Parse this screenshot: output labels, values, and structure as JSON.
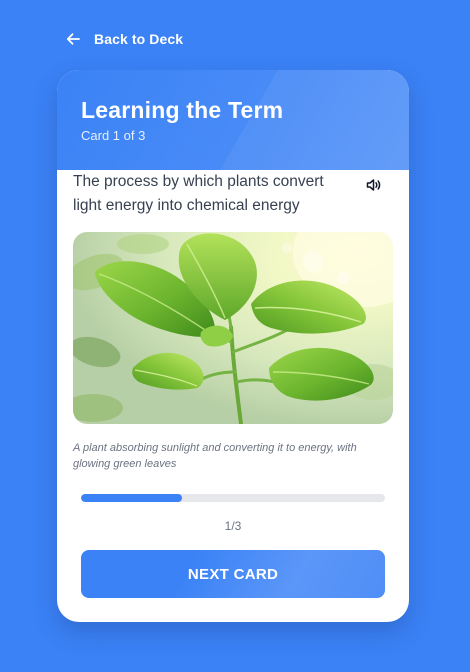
{
  "nav": {
    "back_label": "Back to Deck",
    "back_icon": "arrow-left-icon"
  },
  "card": {
    "title": "Learning the Term",
    "subtitle": "Card 1 of 3",
    "definition": "The process by which plants convert light energy into chemical energy",
    "audio_icon": "speaker-icon",
    "image_alt": "A plant absorbing sunlight and converting it to energy, with glowing green leaves",
    "caption": "A plant absorbing sunlight and converting it to energy, with glowing green leaves"
  },
  "progress": {
    "fraction": 0.3333,
    "counter": "1/3"
  },
  "actions": {
    "next_label": "NEXT CARD"
  },
  "colors": {
    "background": "#3b82f6",
    "accent": "#3b82f6",
    "track": "#e5e7eb",
    "text": "#374151"
  }
}
